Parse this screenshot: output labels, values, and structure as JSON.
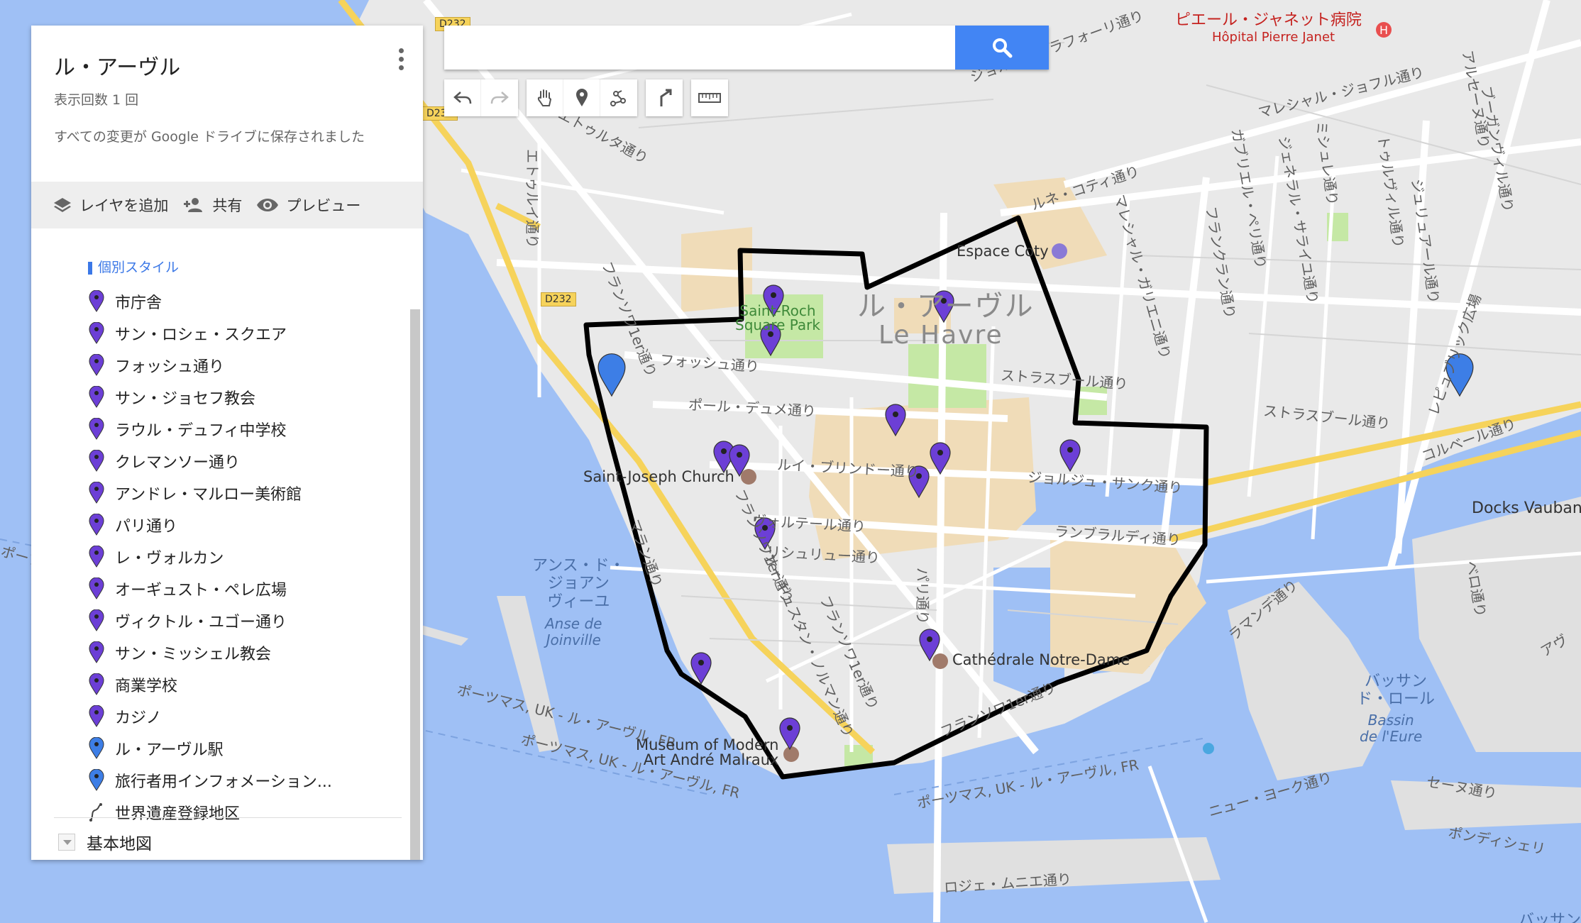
{
  "map": {
    "labels": {
      "rue_ets": "エトゥルタ通り",
      "rue_etu": "エトゥルイ通り",
      "francois1": "フランソワ1er通り",
      "francois2": "フランソワ1er通り",
      "francois3": "フランソワ1er通り",
      "foch": "フォッシュ通り",
      "paul_doumer": "ポール・デュメ通り",
      "louis_brindeau": "ルイ・ブリンドー通り",
      "voltaire": "ヴォルテール通り",
      "richelieu": "リシュリュー通り",
      "paris": "パリ通り",
      "auguste_normand": "オーギュスタン・ノルマン通り",
      "strasbourg1": "ストラスブール通り",
      "strasbourg2": "ストラスブール通り",
      "georges_sand": "ジョルジュ・サンク通り",
      "lamblardie": "ランブラルディ通り",
      "maltan": "フランソワ1er通り",
      "rene_coty": "ルネ・コティ通り",
      "joffre1": "マレシャル・ジョフル通り",
      "joffre2": "ジョルジュ・ラフォーリ通り",
      "marechal_gallieni": "マレシャル・ガリエニ通り",
      "frankran": "フランクラン通り",
      "gabriel_peri": "ガブリエル・ペリ通り",
      "general_sarrail": "ジェネラル・サライユ通り",
      "michelet": "ミシュレ通り",
      "tourville": "トゥルヴィル通り",
      "juliaur": "ジュリュアール通り",
      "bourgainville": "ブーガンヴィル通り",
      "rue_right": "アルセーヌ通り",
      "republique": "レピュブリック広場",
      "colbert": "コルベール通り",
      "berro": "ベロ通り",
      "ramandais": "ラマンデ通り",
      "newyork": "ニュー・ヨーク通り",
      "seine": "セーヌ通り",
      "pondicherry": "ポンディシェリ",
      "roger": "ロジェ・ムニエ通り",
      "portsmouth1": "ポーツマス, UK - ル・アーヴル, FR",
      "portsmouth2": "ポーツマス, UK - ル・アーヴル, FR",
      "portsmouth3": "ポーツマス, UK - ル・アーヴル, FR",
      "left_edge": "ポーツマス",
      "aou": "アヴ",
      "flandre": "マラン通り",
      "d232a": "D232",
      "d232b": "D232",
      "d232c": "D232",
      "le_havre_jp": "ル・アーヴル",
      "le_havre_fr": "Le Havre",
      "anse_jp": "アンス・ド・\nジョアン\nヴィーユ",
      "anse_fr": "Anse de\nJoinville",
      "bassin_jp": "バッサン\nド・ロール",
      "bassin_fr": "Bassin\nde l'Eure",
      "saint_roch": "Saint-Roch\nSquare Park",
      "espace_coty": "Espace Coty",
      "saint_joseph": "Saint-Joseph Church",
      "cathedrale": "Cathédrale Notre-Dame",
      "museum": "Museum of Modern\nArt André Malraux",
      "docks": "Docks Vauban",
      "hospital_jp": "ピエール・ジャネット病院",
      "hospital_fr": "Hôpital Pierre Janet",
      "bottom_right": "バッサン"
    }
  },
  "panel": {
    "title": "ル・アーヴル",
    "views": "表示回数 1 回",
    "saved": "すべての変更が Google ドライブに保存されました",
    "toolbar": {
      "add_layer": "レイヤを追加",
      "share": "共有",
      "preview": "プレビュー"
    },
    "partial_item": "個別スタイル",
    "items": [
      {
        "label": "市庁舎",
        "icon": "purple-pin-icon"
      },
      {
        "label": "サン・ロシェ・スクエア",
        "icon": "purple-pin-icon"
      },
      {
        "label": "フォッシュ通り",
        "icon": "purple-pin-icon"
      },
      {
        "label": "サン・ジョセフ教会",
        "icon": "purple-pin-icon"
      },
      {
        "label": "ラウル・デュフィ中学校",
        "icon": "purple-pin-icon"
      },
      {
        "label": "クレマンソー通り",
        "icon": "purple-pin-icon"
      },
      {
        "label": "アンドレ・マルロー美術館",
        "icon": "purple-pin-icon"
      },
      {
        "label": "パリ通り",
        "icon": "purple-pin-icon"
      },
      {
        "label": "レ・ヴォルカン",
        "icon": "purple-pin-icon"
      },
      {
        "label": "オーギュスト・ペレ広場",
        "icon": "purple-pin-icon"
      },
      {
        "label": "ヴィクトル・ユゴー通り",
        "icon": "purple-pin-icon"
      },
      {
        "label": "サン・ミッシェル教会",
        "icon": "purple-pin-icon"
      },
      {
        "label": "商業学校",
        "icon": "purple-pin-icon"
      },
      {
        "label": "カジノ",
        "icon": "purple-pin-icon"
      },
      {
        "label": "ル・アーヴル駅",
        "icon": "blue-pin-icon"
      },
      {
        "label": "旅行者用インフォメーション...",
        "icon": "blue-pin-icon"
      },
      {
        "label": "世界遺産登録地区",
        "icon": "line-icon"
      }
    ],
    "basemap": "基本地図"
  },
  "search": {
    "placeholder": "",
    "value": ""
  },
  "colors": {
    "water": "#9fc0f5",
    "land": "#e8e8e8",
    "park": "#c5e8a5",
    "building": "#f0dcb8",
    "pin_purple": "#6c3fd6",
    "pin_blue": "#3d7ee6",
    "accent": "#4285f4"
  }
}
